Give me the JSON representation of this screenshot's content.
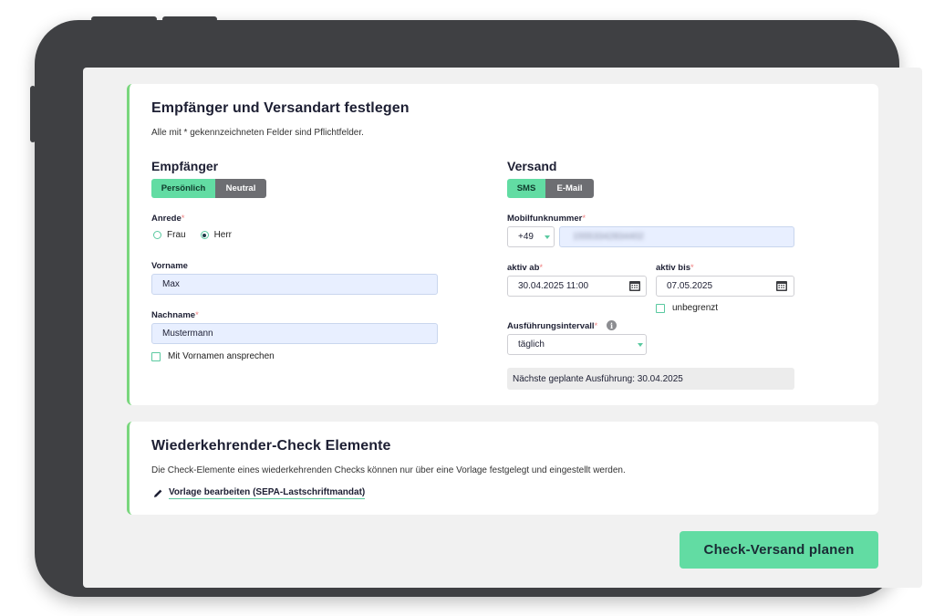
{
  "card1": {
    "title": "Empfänger und Versandart festlegen",
    "note": "Alle mit * gekennzeichneten Felder sind Pflichtfelder.",
    "recipient": {
      "heading": "Empfänger",
      "toggle_active": "Persönlich",
      "toggle_inactive": "Neutral",
      "salutation_label": "Anrede",
      "salutation_options": [
        "Frau",
        "Herr"
      ],
      "salutation_selected": "Herr",
      "firstname_label": "Vorname",
      "firstname_value": "Max",
      "lastname_label": "Nachname",
      "lastname_value": "Mustermann",
      "address_by_firstname_label": "Mit Vornamen ansprechen"
    },
    "shipping": {
      "heading": "Versand",
      "toggle_active": "SMS",
      "toggle_inactive": "E-Mail",
      "mobile_label": "Mobilfunknummer",
      "country_code": "+49",
      "mobile_value": "15553342834402",
      "active_from_label": "aktiv ab",
      "active_from_value": "30.04.2025 11:00",
      "active_until_label": "aktiv bis",
      "active_until_value": "07.05.2025",
      "unlimited_label": "unbegrenzt",
      "interval_label": "Ausführungsintervall",
      "interval_value": "täglich",
      "next_run": "Nächste geplante Ausführung: 30.04.2025"
    },
    "required_marker": "*"
  },
  "card2": {
    "title": "Wiederkehrender-Check Elemente",
    "description": "Die Check-Elemente eines wiederkehrenden Checks können nur über eine Vorlage festgelegt und eingestellt werden.",
    "link": "Vorlage bearbeiten (SEPA-Lastschriftmandat)"
  },
  "cta_label": "Check-Versand planen",
  "colors": {
    "accent": "#62dca3",
    "card_border": "#79d67d",
    "frame": "#3f4043",
    "input_bg": "#e8efff"
  },
  "icons": [
    "info-icon",
    "calendar-icon",
    "pencil-icon",
    "chevron-down-icon"
  ]
}
